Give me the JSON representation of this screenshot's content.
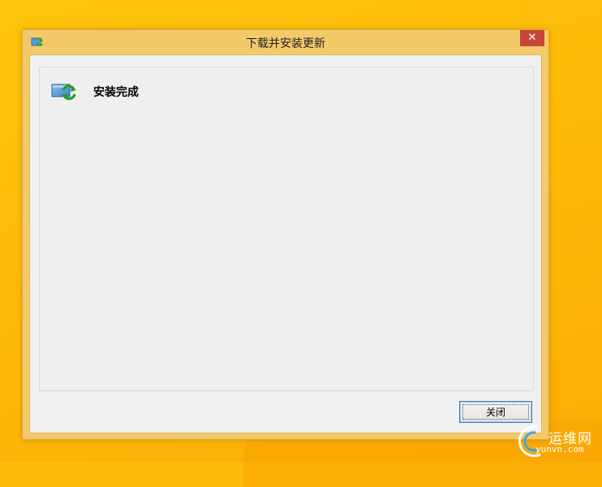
{
  "window": {
    "title": "下载并安装更新",
    "close_glyph": "✕"
  },
  "content": {
    "status_text": "安装完成"
  },
  "buttons": {
    "close_label": "关闭"
  },
  "watermark": {
    "cn": "运维网",
    "en": "yunvn.com"
  },
  "icons": {
    "title": "update-arrows-icon",
    "status": "windows-update-icon",
    "watermark": "watermark-logo"
  },
  "colors": {
    "desktop": "#fdbb0a",
    "frame": "#f3c96a",
    "close_button": "#c7463a",
    "client": "#f0f0f0",
    "focus_border": "#3c7fb1"
  }
}
